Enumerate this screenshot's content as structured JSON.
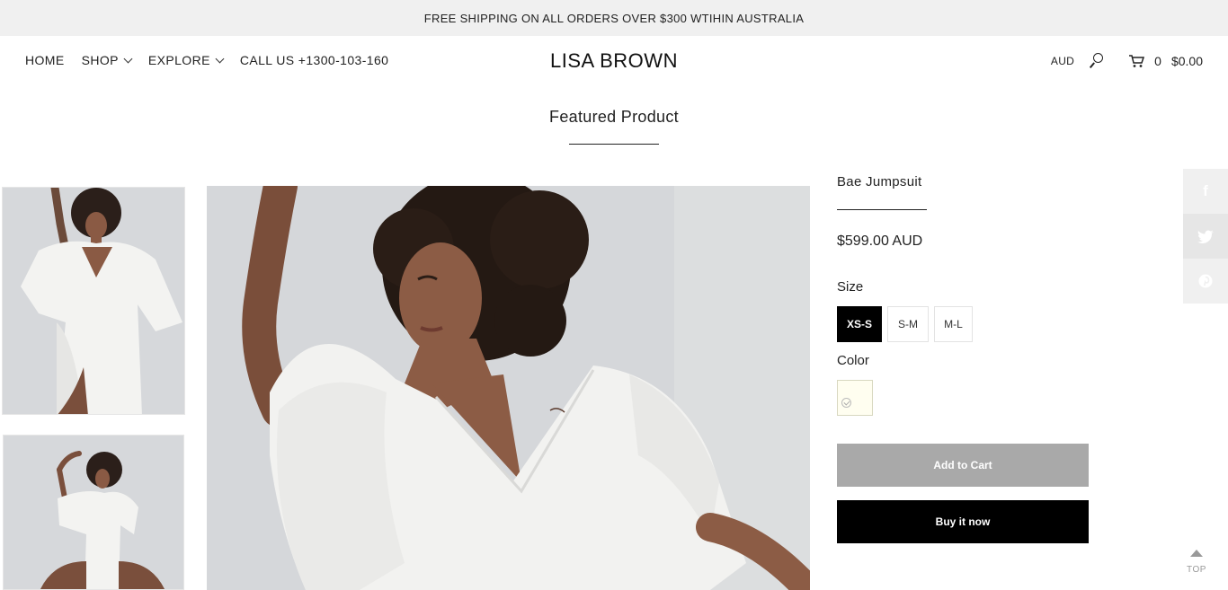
{
  "announcement": "FREE SHIPPING ON ALL ORDERS OVER $300 WTIHIN AUSTRALIA",
  "nav": {
    "home": "HOME",
    "shop": "SHOP",
    "explore": "EXPLORE",
    "call": "CALL US +1300-103-160"
  },
  "brand": "LISA BROWN",
  "utility": {
    "currency": "AUD",
    "cart_count": "0",
    "cart_total": "$0.00"
  },
  "section_title": "Featured Product",
  "product": {
    "name": "Bae Jumpsuit",
    "price": "$599.00 AUD",
    "size_label": "Size",
    "sizes": [
      "XS-S",
      "S-M",
      "M-L"
    ],
    "selected_size": "XS-S",
    "color_label": "Color",
    "add_to_cart": "Add to Cart",
    "buy_now": "Buy it now"
  },
  "share": {
    "facebook": "f",
    "twitter": "t",
    "pinterest": "p"
  },
  "top_label": "TOP",
  "icons": [
    "search-icon",
    "cart-icon",
    "chevron-down-icon",
    "facebook-icon",
    "twitter-icon",
    "pinterest-icon",
    "arrow-up-icon",
    "checkmark-icon"
  ],
  "colors": {
    "announcement_bg": "#f0f0f0",
    "button_add": "#a9a9a9",
    "button_buy": "#000000",
    "swatch": "#fffef0"
  }
}
